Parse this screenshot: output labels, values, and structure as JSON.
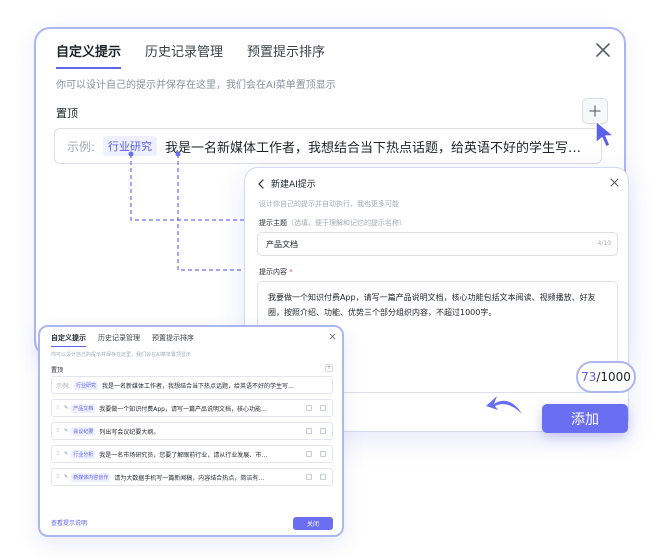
{
  "main": {
    "tabs": [
      {
        "label": "自定义提示",
        "active": true
      },
      {
        "label": "历史记录管理",
        "active": false
      },
      {
        "label": "预置提示排序",
        "active": false
      }
    ],
    "description": "你可以设计自己的提示并保存在这里，我们会在AI菜单置顶显示",
    "pin_label": "置顶",
    "example_label": "示例:",
    "example_tag": "行业研究",
    "example_text": "我是一名新媒体工作者，我想结合当下热点话题，给英语不好的学生写…"
  },
  "new_dialog": {
    "title": "新建AI提示",
    "description": "设计你自己的提示并自动执行，我也更多可能",
    "theme_label": "提示主题",
    "theme_hint": "（选填，便于理解和记忆的提示名称）",
    "theme_value": "产品文档",
    "theme_count": "4/10",
    "content_label": "提示内容",
    "content_required": "*",
    "content_value": "我要做一个知识付费App，请写一篇产品说明文档，核心功能包括文本阅读、视频播放、好友圈，按照介绍、功能、优势三个部分组织内容，不超过1000字。",
    "counter_current": "73",
    "counter_total": "/1000",
    "add_label": "添加"
  },
  "mini": {
    "tabs": [
      {
        "label": "自定义提示",
        "active": true
      },
      {
        "label": "历史记录管理",
        "active": false
      },
      {
        "label": "预置提示排序",
        "active": false
      }
    ],
    "description": "你可以设计自己的提示并保存在这里，我们会在AI菜单置顶显示",
    "pin_label": "置顶",
    "plus": "+",
    "rows": [
      {
        "example": "示例:",
        "tag": "行业研究",
        "text": "我是一名新媒体工作者，我想结合当下热点话题，给英语不好的学生写…"
      },
      {
        "tag": "产品文档",
        "text": "我要做一个知识付费App，请写一篇产品说明文档，核心功能…"
      },
      {
        "tag": "会议纪要",
        "text": "列出写会议纪要大纲。"
      },
      {
        "tag": "行业分析",
        "text": "我是一名市场研究员，您要了解眼前行业，请从行业发展、市…"
      },
      {
        "tag": "新媒体内容创作",
        "text": "请为大数据手机写一篇新闻稿，内容结合热点，简洁有…"
      }
    ],
    "footer_link": "查看提示说明",
    "close_label": "关闭"
  },
  "colors": {
    "accent": "#6a6ef0",
    "border_accent": "#aeb6f0",
    "tag_bg": "#eef0ff"
  },
  "icons": [
    "close-icon",
    "plus-icon",
    "cursor-pointer-icon",
    "back-arrow-icon",
    "curved-arrow-icon",
    "drag-handle-icon",
    "edit-icon"
  ]
}
